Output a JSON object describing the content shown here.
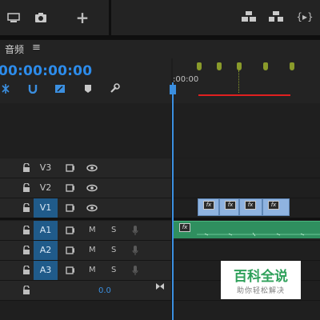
{
  "panel": {
    "title": "音频",
    "menu_glyph": "≡"
  },
  "timecode": "00:00:00:00",
  "ruler": {
    "time_label": ":00:00"
  },
  "tracks": {
    "video": [
      {
        "label": "V3",
        "selected": false
      },
      {
        "label": "V2",
        "selected": false
      },
      {
        "label": "V1",
        "selected": true
      }
    ],
    "audio": [
      {
        "label": "A1",
        "selected": true,
        "m": "M",
        "s": "S"
      },
      {
        "label": "A2",
        "selected": true,
        "m": "M",
        "s": "S"
      },
      {
        "label": "A3",
        "selected": true,
        "m": "M",
        "s": "S"
      }
    ]
  },
  "master": {
    "value": "0.0"
  },
  "clips": {
    "fx_label": "fx"
  },
  "top": {
    "plus": "+"
  },
  "watermark": {
    "main": "百科全说",
    "sub": "助你轻松解决"
  },
  "colors": {
    "accent": "#2d8ceb",
    "video_clip": "#8fb3e0",
    "audio_clip": "#2f8f5f",
    "work_area": "#e02020",
    "marker": "#8a9b2b"
  }
}
